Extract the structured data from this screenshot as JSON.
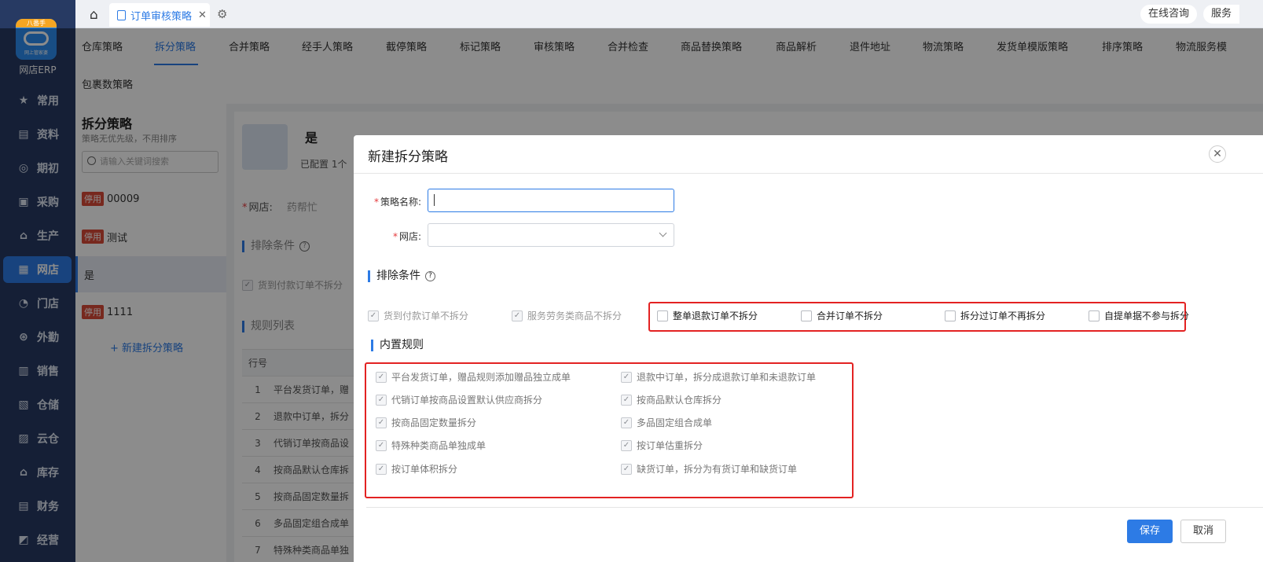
{
  "app": {
    "logo_badge": "八番手",
    "logo_text": "网上管家婆",
    "name": "网店ERP"
  },
  "sidebar": {
    "items": [
      {
        "label": "常用",
        "icon": "star-icon"
      },
      {
        "label": "资料",
        "icon": "document-icon"
      },
      {
        "label": "期初",
        "icon": "target-icon"
      },
      {
        "label": "采购",
        "icon": "purchase-icon"
      },
      {
        "label": "生产",
        "icon": "production-icon"
      },
      {
        "label": "网店",
        "icon": "store-icon"
      },
      {
        "label": "门店",
        "icon": "pie-icon"
      },
      {
        "label": "外勤",
        "icon": "field-icon"
      },
      {
        "label": "销售",
        "icon": "sales-chart-icon"
      },
      {
        "label": "仓储",
        "icon": "warehouse-icon"
      },
      {
        "label": "云仓",
        "icon": "cloud-warehouse-icon"
      },
      {
        "label": "库存",
        "icon": "inventory-icon"
      },
      {
        "label": "财务",
        "icon": "finance-icon"
      },
      {
        "label": "经营",
        "icon": "business-icon"
      }
    ],
    "active_index": 5
  },
  "topbar": {
    "tab_label": "订单审核策略",
    "online_consult": "在线咨询",
    "service": "服务"
  },
  "strategy_tabs": [
    "仓库策略",
    "拆分策略",
    "合并策略",
    "经手人策略",
    "截停策略",
    "标记策略",
    "审核策略",
    "合并检查",
    "商品替换策略",
    "商品解析",
    "退件地址",
    "物流策略",
    "发货单模版策略",
    "排序策略",
    "物流服务模",
    "包裹数策略"
  ],
  "list_panel": {
    "title": "拆分策略",
    "subtitle": "策略无优先级，不用排序",
    "search_placeholder": "请输入关键词搜索",
    "items": [
      {
        "badge": "停用",
        "name": "00009"
      },
      {
        "badge": "停用",
        "name": "测试"
      },
      {
        "badge": "",
        "name": "是"
      },
      {
        "badge": "停用",
        "name": "1111"
      }
    ],
    "new_button": "+ 新建拆分策略"
  },
  "detail": {
    "name": "是",
    "meta": "已配置  1个",
    "store_label": "网店:",
    "store_value": "药帮忙",
    "exclude_title": "排除条件",
    "exclude_item": "货到付款订单不拆分",
    "rules_title": "规则列表",
    "table_header": "行号",
    "rows": [
      {
        "no": "1",
        "text": "平台发货订单，赠"
      },
      {
        "no": "2",
        "text": "退款中订单，拆分"
      },
      {
        "no": "3",
        "text": "代销订单按商品设"
      },
      {
        "no": "4",
        "text": "按商品默认仓库拆"
      },
      {
        "no": "5",
        "text": "按商品固定数量拆"
      },
      {
        "no": "6",
        "text": "多品固定组合成单"
      },
      {
        "no": "7",
        "text": "特殊种类商品单独"
      }
    ]
  },
  "dialog": {
    "title": "新建拆分策略",
    "name_label": "策略名称:",
    "name_value": "",
    "store_label": "网店:",
    "store_value": "",
    "exclude_title": "排除条件",
    "exclude_disabled": [
      "货到付款订单不拆分",
      "服务劳务类商品不拆分"
    ],
    "exclude_options": [
      "整单退款订单不拆分",
      "合并订单不拆分",
      "拆分过订单不再拆分",
      "自提单据不参与拆分"
    ],
    "builtin_title": "内置规则",
    "builtin_left": [
      "平台发货订单，赠品规则添加赠品独立成单",
      "代销订单按商品设置默认供应商拆分",
      "按商品固定数量拆分",
      "特殊种类商品单独成单",
      "按订单体积拆分"
    ],
    "builtin_right": [
      "退款中订单，拆分成退款订单和未退款订单",
      "按商品默认仓库拆分",
      "多品固定组合成单",
      "按订单估重拆分",
      "缺货订单，拆分为有货订单和缺货订单"
    ],
    "save": "保存",
    "cancel": "取消"
  },
  "colors": {
    "accent": "#2d7be5",
    "sidebar": "#273a63",
    "highlight": "#e32222",
    "badge": "#d94a38"
  }
}
